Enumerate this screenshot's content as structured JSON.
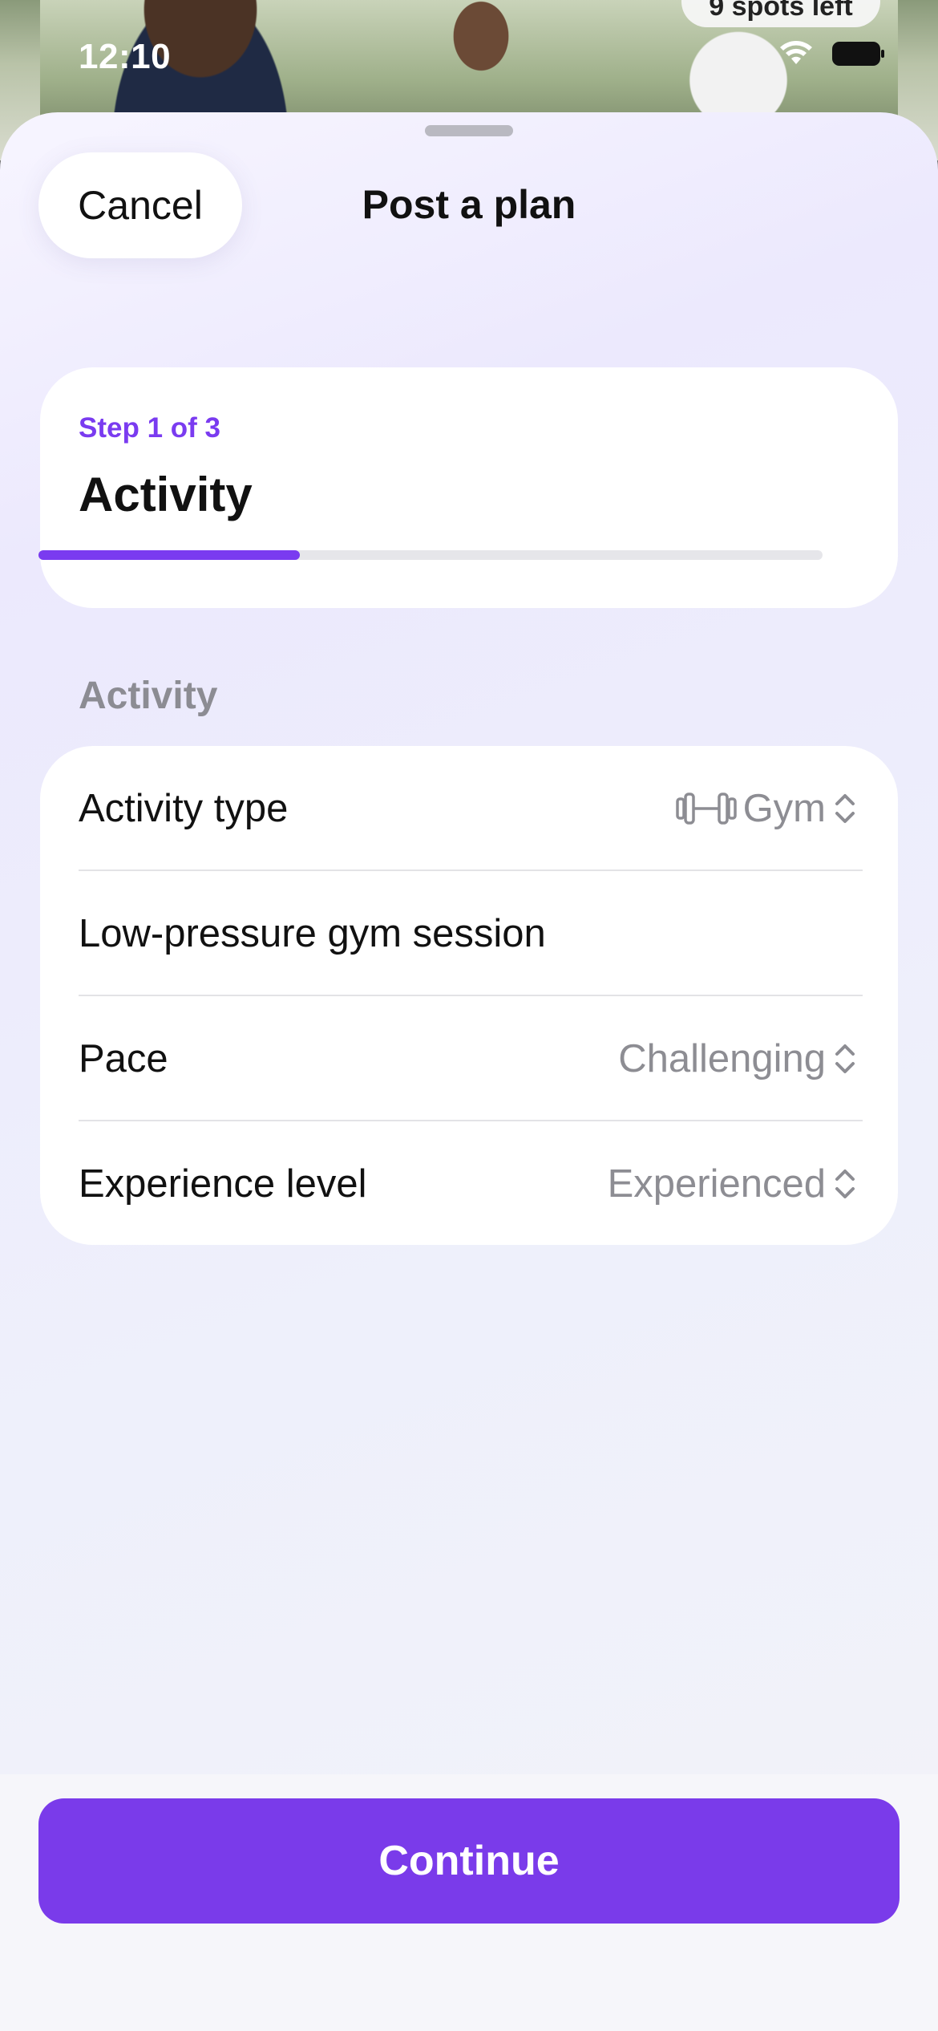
{
  "status_bar": {
    "time": "12:10",
    "icons": [
      "wifi-icon",
      "battery-icon"
    ]
  },
  "background": {
    "badge": "9 spots left"
  },
  "sheet": {
    "cancel_label": "Cancel",
    "title": "Post a plan"
  },
  "step": {
    "label": "Step 1 of 3",
    "title": "Activity",
    "progress": 0.333
  },
  "section": {
    "header": "Activity",
    "rows": [
      {
        "label": "Activity type",
        "value": "Gym",
        "icon": "dumbbell-icon",
        "control": "chevron-up-down-icon"
      },
      {
        "label": "Low-pressure gym session"
      },
      {
        "label": "Pace",
        "value": "Challenging",
        "control": "chevron-up-down-icon"
      },
      {
        "label": "Experience level",
        "value": "Experienced",
        "control": "chevron-up-down-icon"
      }
    ]
  },
  "footer": {
    "continue_label": "Continue"
  },
  "colors": {
    "accent": "#7A3BEA",
    "step_label": "#7A3BF0",
    "secondary_text": "#8D8D93"
  }
}
